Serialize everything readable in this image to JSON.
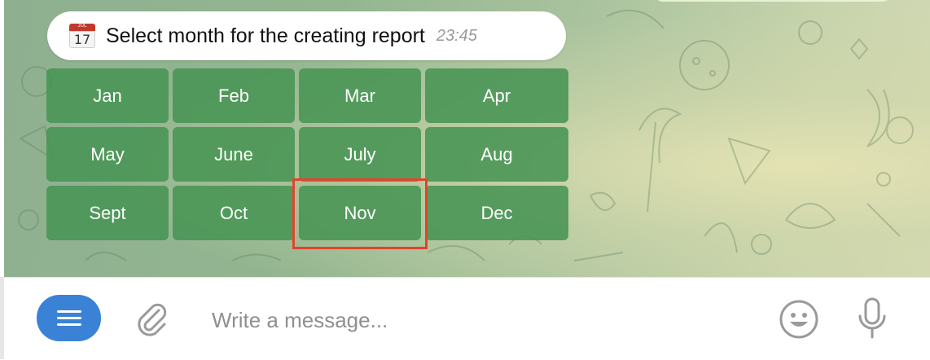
{
  "chat": {
    "message": {
      "icon": "calendar-icon",
      "calendar_day": "17",
      "calendar_month": "JUL",
      "text": "Select month for the creating report",
      "time": "23:45"
    },
    "keyboard": {
      "rows": [
        [
          "Jan",
          "Feb",
          "Mar",
          "Apr"
        ],
        [
          "May",
          "June",
          "July",
          "Aug"
        ],
        [
          "Sept",
          "Oct",
          "Nov",
          "Dec"
        ]
      ],
      "highlighted": "Nov",
      "button_color": "#4a9455",
      "highlight_color": "#e0452a"
    }
  },
  "composer": {
    "menu_icon": "hamburger-menu-icon",
    "attach_icon": "paperclip-icon",
    "placeholder": "Write a message...",
    "emoji_icon": "smiley-icon",
    "mic_icon": "microphone-icon",
    "menu_color": "#3a82d6"
  }
}
